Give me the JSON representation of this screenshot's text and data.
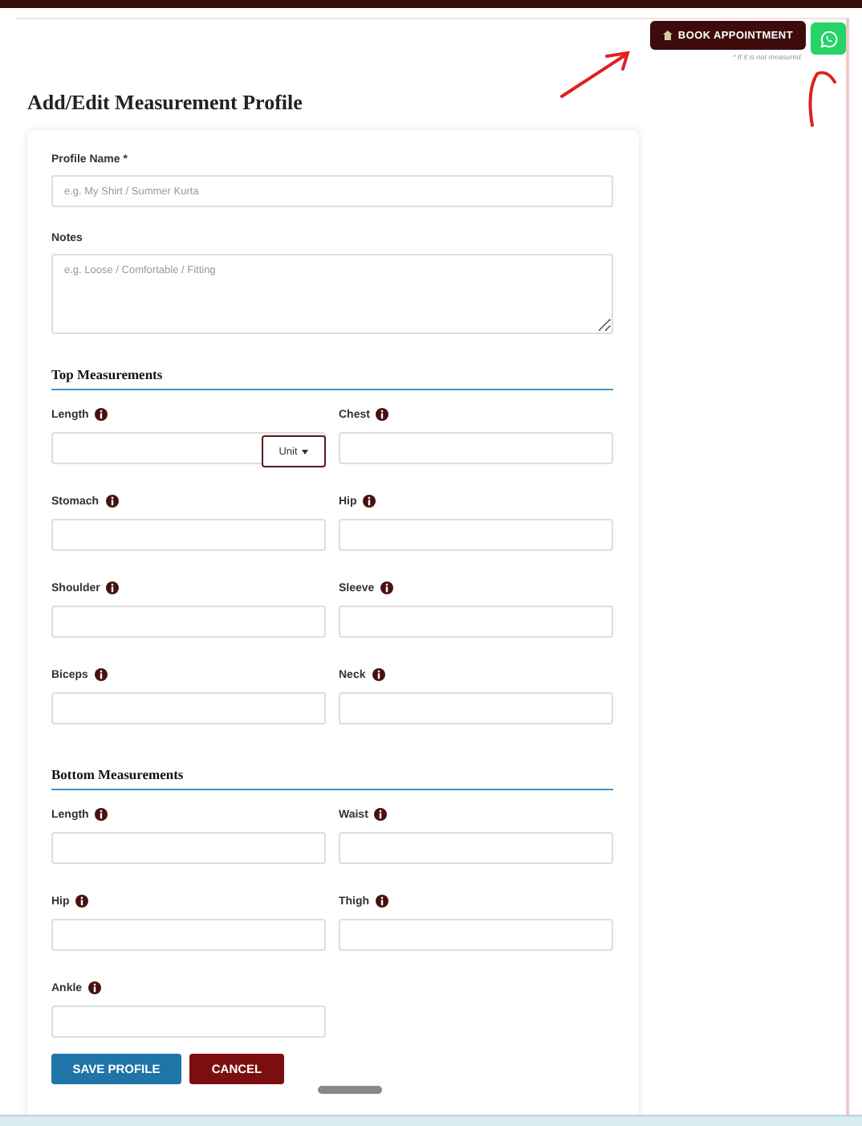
{
  "header": {
    "book_button": "BOOK APPOINTMENT",
    "note": "* If it is not measured."
  },
  "title": "Add/Edit Measurement Profile",
  "profile_name": {
    "label": "Profile Name *",
    "placeholder": "e.g. My Shirt / Summer Kurta"
  },
  "notes": {
    "label": "Notes",
    "placeholder": "e.g. Loose / Comfortable / Fitting"
  },
  "sections": [
    {
      "title": "Top Measurements",
      "fields": [
        {
          "label": "Length",
          "unit": "Unit"
        },
        {
          "label": "Chest"
        },
        {
          "label": "Stomach"
        },
        {
          "label": "Hip"
        },
        {
          "label": "Shoulder"
        },
        {
          "label": "Sleeve"
        },
        {
          "label": "Biceps"
        },
        {
          "label": "Neck"
        }
      ]
    },
    {
      "title": "Bottom Measurements",
      "fields": [
        {
          "label": "Length"
        },
        {
          "label": "Waist"
        },
        {
          "label": "Hip"
        },
        {
          "label": "Thigh"
        },
        {
          "label": "Ankle"
        }
      ]
    }
  ],
  "buttons": [
    {
      "label": "SAVE PROFILE",
      "kind": "primary"
    },
    {
      "label": "CANCEL",
      "kind": "cancel"
    }
  ]
}
